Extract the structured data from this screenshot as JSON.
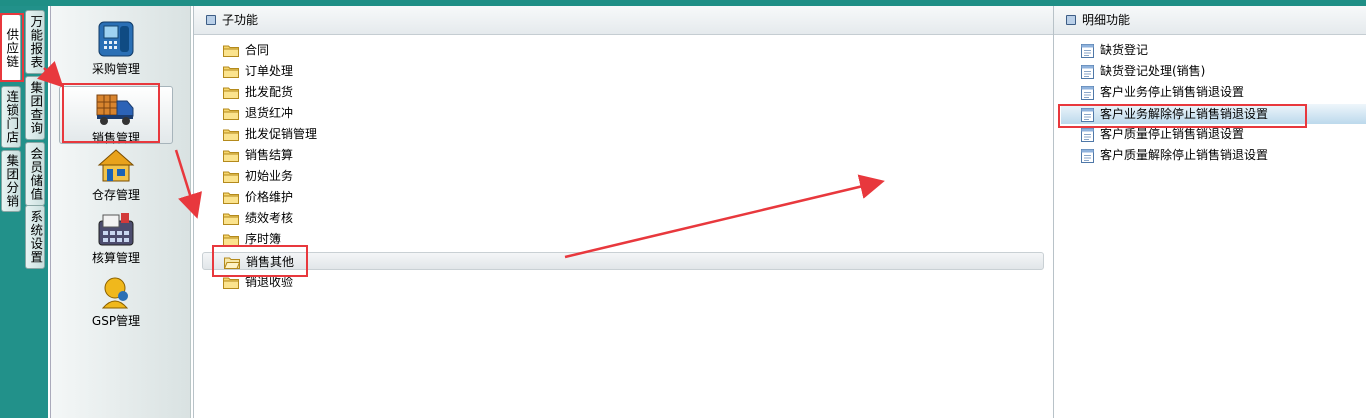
{
  "vertical_tabs": {
    "col1": [
      "供应链",
      "连锁门店",
      "集团分销"
    ],
    "col2": [
      "万能报表",
      "集团查询",
      "会员储值",
      "系统设置"
    ]
  },
  "modules": [
    {
      "label": "采购管理",
      "icon": "purchase-phone-icon"
    },
    {
      "label": "销售管理",
      "icon": "sales-truck-icon"
    },
    {
      "label": "仓存管理",
      "icon": "warehouse-house-icon"
    },
    {
      "label": "核算管理",
      "icon": "accounting-calculator-icon"
    },
    {
      "label": "GSP管理",
      "icon": "gsp-user-icon"
    }
  ],
  "sub_panel": {
    "title": "子功能",
    "items": [
      "合同",
      "订单处理",
      "批发配货",
      "退货红冲",
      "批发促销管理",
      "销售结算",
      "初始业务",
      "价格维护",
      "绩效考核",
      "序时簿",
      "销售其他",
      "销退收验"
    ],
    "selected": "销售其他"
  },
  "detail_panel": {
    "title": "明细功能",
    "items": [
      "缺货登记",
      "缺货登记处理(销售)",
      "客户业务停止销售销退设置",
      "客户业务解除停止销售销退设置",
      "客户质量停止销售销退设置",
      "客户质量解除停止销售销退设置"
    ],
    "highlighted": "客户业务解除停止销售销退设置"
  },
  "colors": {
    "teal": "#22918a",
    "annotation_red": "#e8383d",
    "highlight_blue": "#bcd9ec"
  }
}
